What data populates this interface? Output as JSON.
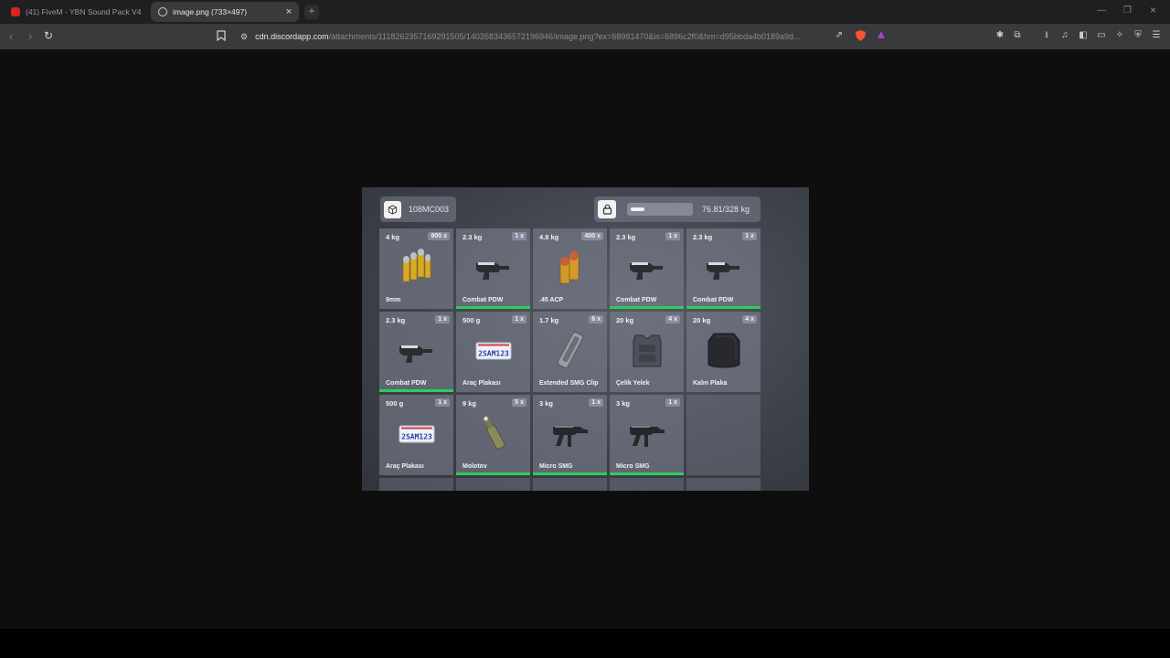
{
  "browser": {
    "tabs": [
      {
        "title": "(41) FiveM - YBN Sound Pack V4 | Sc",
        "active": false
      },
      {
        "title": "image.png (733×497)",
        "active": true
      }
    ],
    "url_host": "cdn.discordapp.com",
    "url_path": "/attachments/1118262357169291505/1403583436572196946/image.png?ex=68981470&is=6896c2f0&hm=d95bbda4b0189a9d..."
  },
  "inventory": {
    "id": "108MC003",
    "weight_text": "76.81/328 kg",
    "weight_fraction": 0.234,
    "slots": [
      {
        "weight": "4 kg",
        "count": "800 x",
        "name": "9mm",
        "icon": "ammo-9mm-icon",
        "durability": false
      },
      {
        "weight": "2.3 kg",
        "count": "1 x",
        "name": "Combat PDW",
        "icon": "combat-pdw-icon",
        "durability": true
      },
      {
        "weight": "4.8 kg",
        "count": "400 x",
        "name": ".45 ACP",
        "icon": "ammo-45acp-icon",
        "durability": false
      },
      {
        "weight": "2.3 kg",
        "count": "1 x",
        "name": "Combat PDW",
        "icon": "combat-pdw-icon",
        "durability": true
      },
      {
        "weight": "2.3 kg",
        "count": "1 x",
        "name": "Combat PDW",
        "icon": "combat-pdw-icon",
        "durability": true
      },
      {
        "weight": "2.3 kg",
        "count": "1 x",
        "name": "Combat PDW",
        "icon": "combat-pdw-icon",
        "durability": true
      },
      {
        "weight": "500 g",
        "count": "1 x",
        "name": "Araç Plakası",
        "icon": "license-plate-icon",
        "plate": "2SAM123",
        "durability": false
      },
      {
        "weight": "1.7 kg",
        "count": "6 x",
        "name": "Extended SMG Clip",
        "icon": "smg-clip-icon",
        "durability": false
      },
      {
        "weight": "20 kg",
        "count": "4 x",
        "name": "Çelik Yelek",
        "icon": "steel-vest-icon",
        "durability": false
      },
      {
        "weight": "20 kg",
        "count": "4 x",
        "name": "Kalın Plaka",
        "icon": "armor-plate-icon",
        "durability": false
      },
      {
        "weight": "500 g",
        "count": "1 x",
        "name": "Araç Plakası",
        "icon": "license-plate-icon",
        "plate": "2SAM123",
        "durability": false
      },
      {
        "weight": "9 kg",
        "count": "5 x",
        "name": "Molotov",
        "icon": "molotov-icon",
        "durability": true
      },
      {
        "weight": "3 kg",
        "count": "1 x",
        "name": "Micro SMG",
        "icon": "micro-smg-icon",
        "durability": true
      },
      {
        "weight": "3 kg",
        "count": "1 x",
        "name": "Micro SMG",
        "icon": "micro-smg-icon",
        "durability": true
      }
    ]
  },
  "colors": {
    "durability": "#2ecc5b",
    "slot_bg": "#7d808f",
    "brave": "#fb542b"
  }
}
